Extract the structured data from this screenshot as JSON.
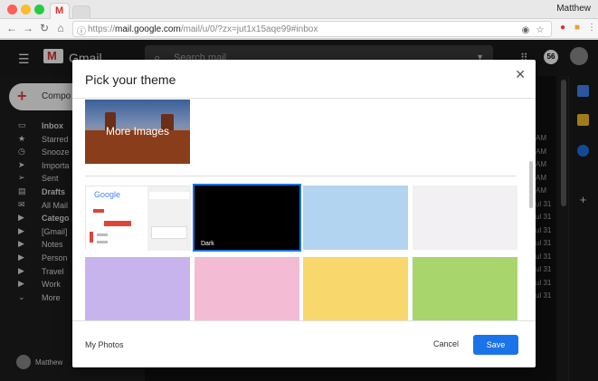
{
  "browser": {
    "user_name": "Matthew",
    "url_prefix": "https://",
    "url_host": "mail.google.com",
    "url_path": "/mail/u/0/?zx=jut1x15aqe99#inbox"
  },
  "gmail": {
    "app_name": "Gmail",
    "search_placeholder": "Search mail",
    "notification_count": "56",
    "compose_label": "Compo"
  },
  "sidebar": {
    "items": [
      {
        "label": "Inbox",
        "icon": "inbox-icon",
        "bold": true
      },
      {
        "label": "Starred",
        "icon": "star-icon",
        "bold": false
      },
      {
        "label": "Snooze",
        "icon": "clock-icon",
        "bold": false
      },
      {
        "label": "Importa",
        "icon": "important-icon",
        "bold": false
      },
      {
        "label": "Sent",
        "icon": "send-icon",
        "bold": false
      },
      {
        "label": "Drafts",
        "icon": "draft-icon",
        "bold": true
      },
      {
        "label": "All Mail",
        "icon": "mail-icon",
        "bold": false
      },
      {
        "label": "Catego",
        "icon": "label-icon",
        "bold": true
      },
      {
        "label": "[Gmail]",
        "icon": "label-icon",
        "bold": false
      },
      {
        "label": "Notes",
        "icon": "label-icon",
        "bold": false
      },
      {
        "label": "Person",
        "icon": "label-icon",
        "bold": false
      },
      {
        "label": "Travel",
        "icon": "label-icon",
        "bold": false
      },
      {
        "label": "Work",
        "icon": "label-icon",
        "bold": false
      },
      {
        "label": "More",
        "icon": "chevron-down-icon",
        "bold": false
      }
    ],
    "account_label": "Matthew"
  },
  "mail_dates": [
    "AM",
    "AM",
    "AM",
    "AM",
    "AM",
    "ul 31",
    "ul 31",
    "ul 31",
    "ul 31",
    "ul 31",
    "ul 31",
    "ul 31",
    "ul 31"
  ],
  "dialog": {
    "title": "Pick your theme",
    "more_images_label": "More Images",
    "dark_label": "Dark",
    "my_photos_label": "My Photos",
    "cancel_label": "Cancel",
    "save_label": "Save",
    "google_logo_text": "Google",
    "themes": [
      {
        "name": "default",
        "color": "#ffffff"
      },
      {
        "name": "dark",
        "color": "#000000"
      },
      {
        "name": "light-blue",
        "color": "#b3d4f0"
      },
      {
        "name": "light-gray",
        "color": "#f2f0f2"
      },
      {
        "name": "lavender",
        "color": "#c8b4ec"
      },
      {
        "name": "pink",
        "color": "#f4bcd4"
      },
      {
        "name": "yellow",
        "color": "#f8d86c"
      },
      {
        "name": "green",
        "color": "#a8d66c"
      }
    ]
  },
  "colors": {
    "accent": "#1a73e8",
    "gmail_red": "#d93025"
  }
}
